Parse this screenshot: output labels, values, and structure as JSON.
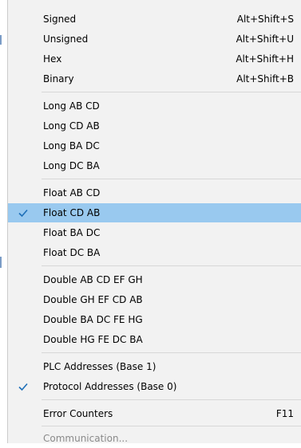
{
  "menu": {
    "items": [
      {
        "label": "Signed",
        "shortcut": "Alt+Shift+S"
      },
      {
        "label": "Unsigned",
        "shortcut": "Alt+Shift+U"
      },
      {
        "label": "Hex",
        "shortcut": "Alt+Shift+H"
      },
      {
        "label": "Binary",
        "shortcut": "Alt+Shift+B"
      },
      {
        "label": "Long AB CD"
      },
      {
        "label": "Long CD AB"
      },
      {
        "label": "Long BA DC"
      },
      {
        "label": "Long DC BA"
      },
      {
        "label": "Float AB CD"
      },
      {
        "label": "Float CD AB",
        "checked": true
      },
      {
        "label": "Float BA DC"
      },
      {
        "label": "Float DC BA"
      },
      {
        "label": "Double AB CD EF GH"
      },
      {
        "label": "Double GH EF CD AB"
      },
      {
        "label": "Double BA DC FE HG"
      },
      {
        "label": "Double HG FE DC BA"
      },
      {
        "label": "PLC Addresses (Base 1)"
      },
      {
        "label": "Protocol Addresses (Base 0)",
        "checked": true
      },
      {
        "label": "Error Counters",
        "shortcut": "F11"
      },
      {
        "label": "Communication...",
        "disabled": true
      }
    ],
    "highlighted_item": "Float CD AB"
  },
  "colors": {
    "menu_background": "#f2f2f2",
    "highlight": "#99c9ef",
    "checkmark": "#1d6fb8",
    "separator": "#d7d7d7",
    "disabled_text": "#8a8a8a"
  }
}
